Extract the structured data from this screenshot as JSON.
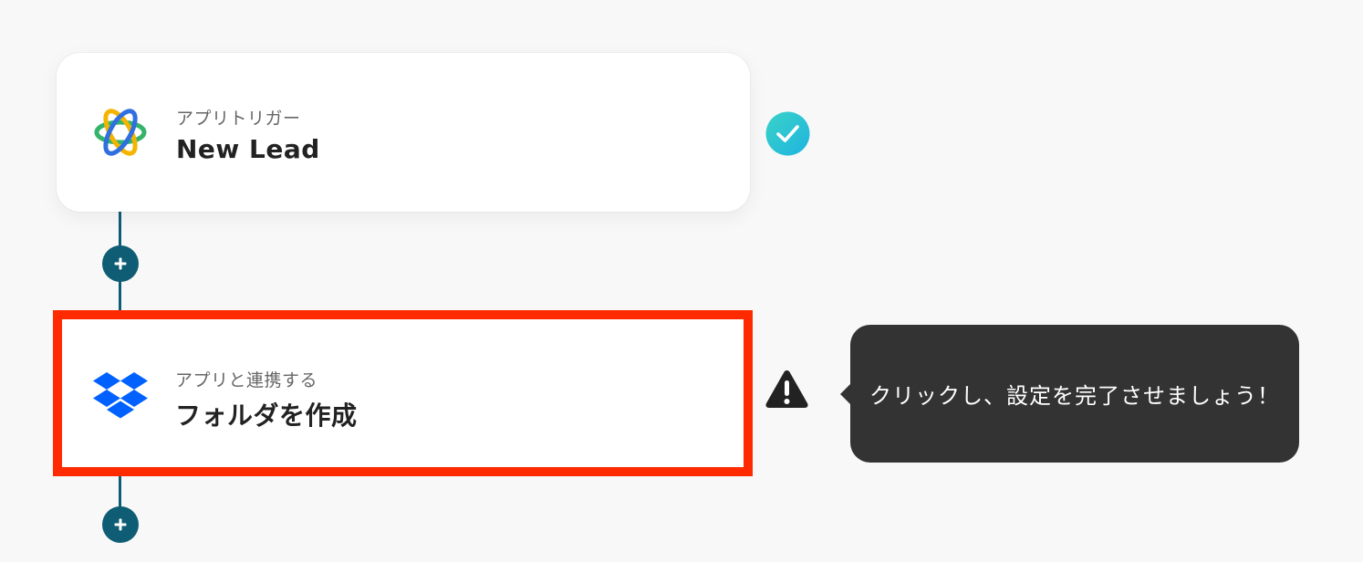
{
  "flow": {
    "steps": [
      {
        "type_label": "アプリトリガー",
        "title": "New Lead",
        "app_icon": "orbit-logo-icon",
        "status": "completed",
        "status_icon": "check-circle-icon"
      },
      {
        "type_label": "アプリと連携する",
        "title": "フォルダを作成",
        "app_icon": "dropbox-icon",
        "status": "needs-setup",
        "status_icon": "warning-icon",
        "highlighted": true
      }
    ],
    "add_step_icon": "plus-icon"
  },
  "tooltip": {
    "text": "クリックし、設定を完了させましょう！"
  },
  "colors": {
    "connector": "#0f5d74",
    "highlight_border": "#ff2a00",
    "check": "#27c5d9",
    "tooltip_bg": "#333333",
    "dropbox_blue": "#0061ff"
  }
}
